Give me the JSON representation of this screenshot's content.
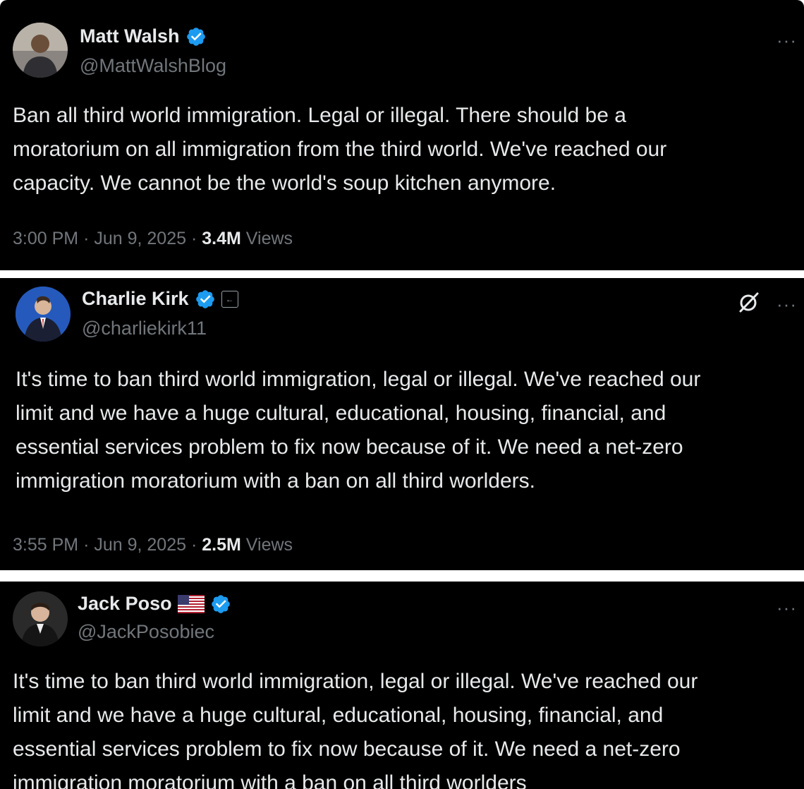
{
  "colors": {
    "background": "#000000",
    "separator": "#ffffff",
    "text_primary": "#e7e9ea",
    "text_secondary": "#71767b",
    "verified_blue": "#1d9bf0"
  },
  "tweets": [
    {
      "author_name": "Matt Walsh",
      "handle": "@MattWalshBlog",
      "verified": true,
      "more_label": "···",
      "text": "Ban all third world immigration. Legal or illegal. There should be a\nmoratorium on all immigration from the third world. We've reached our\ncapacity. We cannot be the world's soup kitchen anymore.",
      "time": "3:00 PM",
      "date": "Jun 9, 2025",
      "views_count": "3.4M",
      "views_label": "Views",
      "icons": [
        "verified-badge-icon",
        "more-icon"
      ]
    },
    {
      "author_name": "Charlie Kirk",
      "handle": "@charliekirk11",
      "verified": true,
      "affiliate_badge": "organization-badge-icon",
      "more_label": "···",
      "text": "It's time to ban third world immigration, legal or illegal. We've reached our\nlimit and we have a huge cultural, educational, housing, financial, and\nessential services problem to fix now because of it. We need a net-zero\nimmigration moratorium with a ban on all third worlders.",
      "time": "3:55 PM",
      "date": "Jun 9, 2025",
      "views_count": "2.5M",
      "views_label": "Views",
      "icons": [
        "verified-badge-icon",
        "organization-badge-icon",
        "grok-icon",
        "more-icon"
      ]
    },
    {
      "author_name": "Jack Poso",
      "handle": "@JackPosobiec",
      "verified": true,
      "flag": "us-flag-icon",
      "more_label": "···",
      "text": "It's time to ban third world immigration, legal or illegal. We've reached our\nlimit and we have a huge cultural, educational, housing, financial, and\nessential services problem to fix now because of it. We need a net-zero\nimmigration moratorium with a ban on all third worlders",
      "icons": [
        "us-flag-icon",
        "verified-badge-icon",
        "more-icon"
      ]
    }
  ]
}
